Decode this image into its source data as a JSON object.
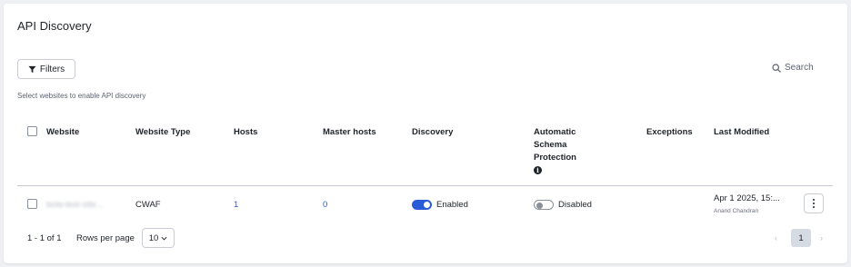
{
  "page": {
    "title": "API Discovery",
    "subtitle": "Select websites to enable API discovery"
  },
  "toolbar": {
    "filters_label": "Filters",
    "search_label": "Search"
  },
  "table": {
    "headers": {
      "website": "Website",
      "website_type": "Website Type",
      "hosts": "Hosts",
      "master_hosts": "Master hosts",
      "discovery": "Discovery",
      "schema_line1": "Automatic",
      "schema_line2": "Schema",
      "schema_line3": "Protection",
      "exceptions": "Exceptions",
      "last_modified": "Last Modified"
    },
    "rows": [
      {
        "website": "bola-test-site...",
        "website_type": "CWAF",
        "hosts": "1",
        "master_hosts": "0",
        "discovery": {
          "label": "Enabled",
          "on": true
        },
        "schema_protection": {
          "label": "Disabled",
          "on": false
        },
        "exceptions": "",
        "last_modified": "Apr 1 2025, 15:...",
        "modified_by": "Anand Chandran"
      }
    ]
  },
  "pagination": {
    "range": "1 - 1 of 1",
    "rows_per_page_label": "Rows per page",
    "rows_per_page_value": "10",
    "prev_icon": "chevron-left-icon",
    "next_icon": "chevron-right-icon",
    "current_page": "1"
  },
  "colors": {
    "accent": "#2a5bd7",
    "page_bg": "#eef0f4",
    "card_bg": "#ffffff",
    "muted": "#5c6370"
  }
}
